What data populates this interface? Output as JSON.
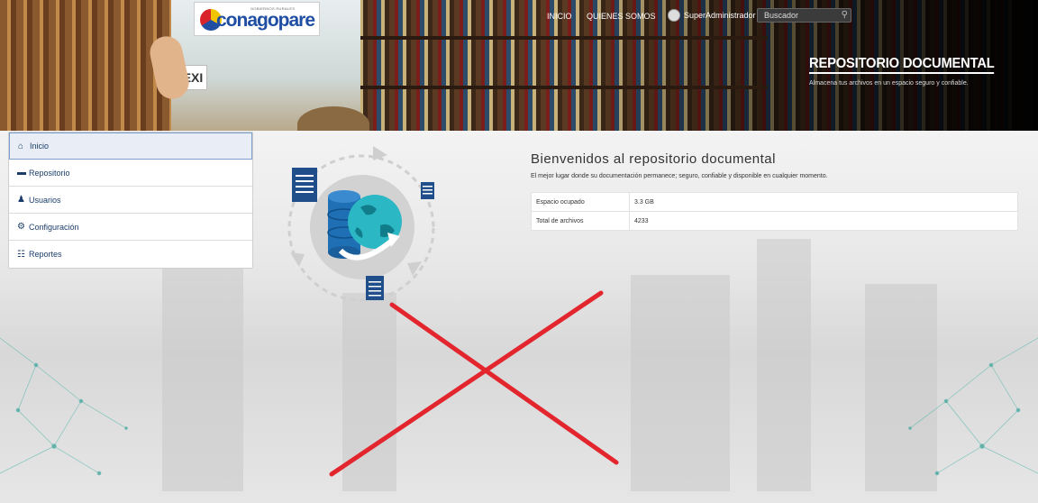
{
  "header": {
    "logo": {
      "small_text": "GOBIERNOS RURALES",
      "name": "conagopare"
    },
    "nav": {
      "inicio": "INICIO",
      "quienes_somos": "QUIENES SOMOS"
    },
    "user": {
      "name": "SuperAdministrador"
    },
    "search": {
      "placeholder": "Buscador",
      "icon": "search-icon"
    },
    "hero": {
      "title": "REPOSITORIO DOCUMENTAL",
      "subtitle": "Almacena tus archivos en un espacio seguro y confiable."
    }
  },
  "sidebar": {
    "items": [
      {
        "label": "Inicio",
        "icon": "home-icon",
        "active": true
      },
      {
        "label": "Repositorio",
        "icon": "folder-icon"
      },
      {
        "label": "Usuarios",
        "icon": "user-icon"
      },
      {
        "label": "Configuración",
        "icon": "gear-icon"
      },
      {
        "label": "Reportes",
        "icon": "clipboard-icon"
      }
    ]
  },
  "main": {
    "title": "Bienvenidos al repositorio documental",
    "subtitle": "El mejor lugar donde su documentación permanece; seguro, confiable y disponible en cualquier momento.",
    "stats": [
      {
        "label": "Espacio ocupado",
        "value": "3.3 GB"
      },
      {
        "label": "Total de archivos",
        "value": "4233"
      }
    ]
  },
  "colors": {
    "menu_text": "#1a3d6b",
    "cross": "#e3262e",
    "illustration_blue": "#1f6fb5",
    "illustration_teal": "#2bb7c4"
  }
}
